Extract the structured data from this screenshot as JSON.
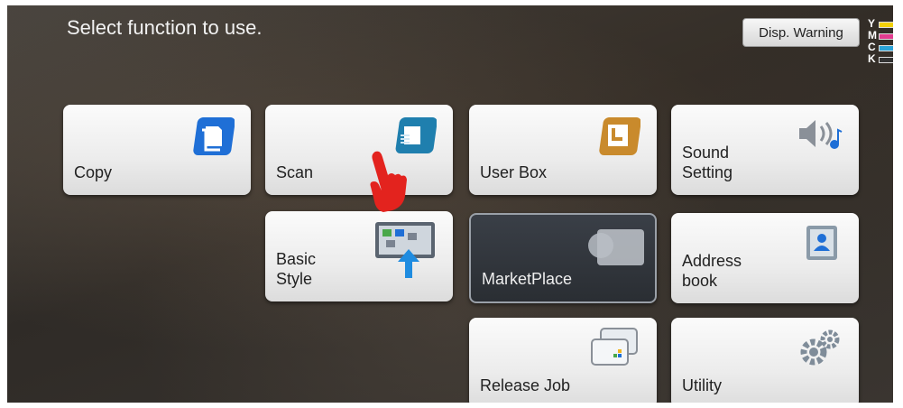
{
  "header": {
    "title": "Select function to use.",
    "disp_warning_label": "Disp. Warning"
  },
  "toner": [
    {
      "letter": "Y",
      "color": "#f2d10a",
      "level": 1.0
    },
    {
      "letter": "M",
      "color": "#e23b8f",
      "level": 1.0
    },
    {
      "letter": "C",
      "color": "#2aa3d8",
      "level": 1.0
    },
    {
      "letter": "K",
      "color": "#222222",
      "level": 0.0
    }
  ],
  "tiles": {
    "copy": {
      "label": "Copy"
    },
    "scan": {
      "label": "Scan"
    },
    "user_box": {
      "label": "User Box"
    },
    "sound_setting": {
      "label": "Sound\nSetting"
    },
    "basic_style": {
      "label": "Basic\nStyle"
    },
    "marketplace": {
      "label": "MarketPlace"
    },
    "address_book": {
      "label": "Address\nbook"
    },
    "release_job": {
      "label": "Release Job"
    },
    "utility": {
      "label": "Utility"
    }
  },
  "colors": {
    "icon_blue": "#1f6fd6",
    "icon_gold": "#c98a2c",
    "pointer_red": "#e3231e"
  }
}
